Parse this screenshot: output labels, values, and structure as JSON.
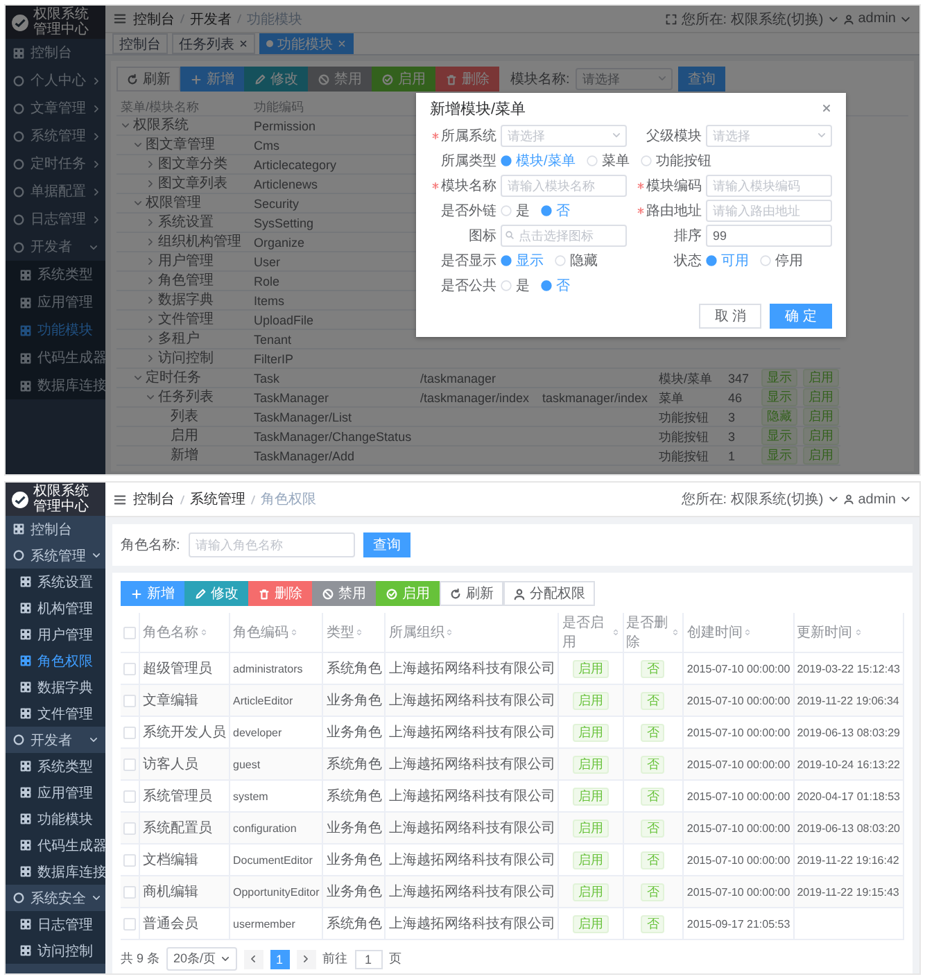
{
  "module_screen": {
    "sidebar": {
      "title": "权限系统管理中心",
      "items": [
        {
          "label": "控制台",
          "selected": false
        },
        {
          "label": "个人中心",
          "selected": false,
          "expanded": false
        },
        {
          "label": "文章管理",
          "selected": false,
          "expanded": false
        },
        {
          "label": "系统管理",
          "selected": false,
          "expanded": false
        },
        {
          "label": "定时任务",
          "selected": false,
          "expanded": false
        },
        {
          "label": "单据配置",
          "selected": false,
          "expanded": false
        },
        {
          "label": "日志管理",
          "selected": false,
          "expanded": false
        },
        {
          "label": "开发者",
          "selected": false,
          "expanded": true,
          "children": [
            {
              "label": "系统类型",
              "selected": false
            },
            {
              "label": "应用管理",
              "selected": false
            },
            {
              "label": "功能模块",
              "selected": true
            },
            {
              "label": "代码生成器",
              "selected": false
            },
            {
              "label": "数据库连接",
              "selected": false
            }
          ]
        }
      ]
    },
    "breadcrumb": [
      "控制台",
      "开发者",
      "功能模块"
    ],
    "fullscreen_button": true,
    "location": {
      "label": "您所在:",
      "value": "权限系统(切换)"
    },
    "user": "admin",
    "tabs": [
      {
        "label": "控制台",
        "selected": false,
        "closable": false
      },
      {
        "label": "任务列表",
        "selected": false,
        "closable": true
      },
      {
        "label": "功能模块",
        "selected": true,
        "closable": true
      }
    ],
    "toolbar": [
      {
        "label": "刷新",
        "kind": "refresh"
      },
      {
        "label": "新增",
        "kind": "add"
      },
      {
        "label": "修改",
        "kind": "edit"
      },
      {
        "label": "禁用",
        "kind": "disable"
      },
      {
        "label": "启用",
        "kind": "enable"
      },
      {
        "label": "删除",
        "kind": "delete"
      }
    ],
    "filter": {
      "label": "模块名称:",
      "placeholder": "请选择",
      "button": "查询"
    },
    "tree_table": {
      "columns": [
        "菜单/模块名称",
        "功能编码"
      ],
      "rows": [
        {
          "name": "权限系统",
          "code": "Permission",
          "expanded": true,
          "children": [
            {
              "name": "图文章管理",
              "code": "Cms",
              "expanded": true,
              "children": [
                {
                  "name": "图文章分类",
                  "code": "Articlecategory",
                  "expanded": false
                },
                {
                  "name": "图文章列表",
                  "code": "Articlenews",
                  "expanded": false
                }
              ]
            },
            {
              "name": "权限管理",
              "code": "Security",
              "expanded": true,
              "children": [
                {
                  "name": "系统设置",
                  "code": "SysSetting",
                  "expanded": false
                },
                {
                  "name": "组织机构管理",
                  "code": "Organize",
                  "expanded": false
                },
                {
                  "name": "用户管理",
                  "code": "User",
                  "expanded": false
                },
                {
                  "name": "角色管理",
                  "code": "Role",
                  "expanded": false
                },
                {
                  "name": "数据字典",
                  "code": "Items",
                  "expanded": false
                },
                {
                  "name": "文件管理",
                  "code": "UploadFile",
                  "expanded": false
                },
                {
                  "name": "多租户",
                  "code": "Tenant",
                  "expanded": false
                },
                {
                  "name": "访问控制",
                  "code": "FilterIP",
                  "expanded": false
                }
              ]
            },
            {
              "name": "定时任务",
              "code": "Task",
              "url": "/taskmanager",
              "type": "模块/菜单",
              "sort": "347",
              "show": "显示",
              "status": "启用",
              "expanded": true,
              "children": [
                {
                  "name": "任务列表",
                  "code": "TaskManager",
                  "url": "/taskmanager/index",
                  "component": "taskmanager/index",
                  "type": "菜单",
                  "sort": "46",
                  "show": "显示",
                  "status": "启用",
                  "expanded": true,
                  "children": [
                    {
                      "name": "列表",
                      "code": "TaskManager/List",
                      "type": "功能按钮",
                      "sort": "3",
                      "show": "隐藏",
                      "status": "启用"
                    },
                    {
                      "name": "启用",
                      "code": "TaskManager/ChangeStatus",
                      "type": "功能按钮",
                      "sort": "3",
                      "show": "显示",
                      "status": "启用"
                    },
                    {
                      "name": "新增",
                      "code": "TaskManager/Add",
                      "type": "功能按钮",
                      "sort": "1",
                      "show": "显示",
                      "status": "启用"
                    }
                  ]
                }
              ]
            }
          ]
        }
      ]
    },
    "dialog": {
      "title": "新增模块/菜单",
      "rows": [
        [
          {
            "kind": "select",
            "label": "所属系统",
            "required": true,
            "placeholder": "请选择"
          },
          {
            "kind": "select",
            "label": "父级模块",
            "required": false,
            "placeholder": "请选择"
          }
        ],
        [
          {
            "kind": "radio",
            "label": "所属类型",
            "required": false,
            "options": [
              {
                "label": "模块/菜单",
                "selected": true
              },
              {
                "label": "菜单",
                "selected": false
              },
              {
                "label": "功能按钮",
                "selected": false
              }
            ]
          }
        ],
        [
          {
            "kind": "input",
            "label": "模块名称",
            "required": true,
            "placeholder": "请输入模块名称"
          },
          {
            "kind": "input",
            "label": "模块编码",
            "required": true,
            "placeholder": "请输入模块编码"
          }
        ],
        [
          {
            "kind": "radio",
            "label": "是否外链",
            "required": false,
            "options": [
              {
                "label": "是",
                "selected": false
              },
              {
                "label": "否",
                "selected": true
              }
            ]
          },
          {
            "kind": "input",
            "label": "路由地址",
            "required": true,
            "placeholder": "请输入路由地址"
          }
        ],
        [
          {
            "kind": "icon",
            "label": "图标",
            "required": false,
            "placeholder": "点击选择图标"
          },
          {
            "kind": "input",
            "label": "排序",
            "required": false,
            "value": "99"
          }
        ],
        [
          {
            "kind": "radio",
            "label": "是否显示",
            "required": false,
            "options": [
              {
                "label": "显示",
                "selected": true
              },
              {
                "label": "隐藏",
                "selected": false
              }
            ]
          },
          {
            "kind": "radio",
            "label": "状态",
            "required": false,
            "options": [
              {
                "label": "可用",
                "selected": true
              },
              {
                "label": "停用",
                "selected": false
              }
            ]
          }
        ],
        [
          {
            "kind": "radio",
            "label": "是否公共",
            "required": false,
            "options": [
              {
                "label": "是",
                "selected": false
              },
              {
                "label": "否",
                "selected": true
              }
            ]
          }
        ]
      ],
      "buttons": [
        {
          "label": "取 消",
          "kind": "cancel"
        },
        {
          "label": "确 定",
          "kind": "primary"
        }
      ]
    }
  },
  "role_screen": {
    "sidebar": {
      "title": "权限系统管理中心",
      "items": [
        {
          "label": "控制台",
          "selected": false
        },
        {
          "label": "系统管理",
          "selected": false,
          "expanded": true,
          "children": [
            {
              "label": "系统设置",
              "selected": false
            },
            {
              "label": "机构管理",
              "selected": false
            },
            {
              "label": "用户管理",
              "selected": false
            },
            {
              "label": "角色权限",
              "selected": true
            },
            {
              "label": "数据字典",
              "selected": false
            },
            {
              "label": "文件管理",
              "selected": false
            }
          ]
        },
        {
          "label": "开发者",
          "selected": false,
          "expanded": true,
          "children": [
            {
              "label": "系统类型",
              "selected": false
            },
            {
              "label": "应用管理",
              "selected": false
            },
            {
              "label": "功能模块",
              "selected": false
            },
            {
              "label": "代码生成器",
              "selected": false
            },
            {
              "label": "数据库连接",
              "selected": false
            }
          ]
        },
        {
          "label": "系统安全",
          "selected": false,
          "expanded": true,
          "children": [
            {
              "label": "日志管理",
              "selected": false
            },
            {
              "label": "访问控制",
              "selected": false
            }
          ]
        }
      ]
    },
    "breadcrumb": [
      "控制台",
      "系统管理",
      "角色权限"
    ],
    "location": {
      "label": "您所在:",
      "value": "权限系统(切换)"
    },
    "user": "admin",
    "search": {
      "label": "角色名称:",
      "placeholder": "请输入角色名称",
      "button": "查询"
    },
    "toolbar": [
      {
        "label": "新增",
        "kind": "add"
      },
      {
        "label": "修改",
        "kind": "edit"
      },
      {
        "label": "删除",
        "kind": "delete"
      },
      {
        "label": "禁用",
        "kind": "disable"
      },
      {
        "label": "启用",
        "kind": "enable"
      },
      {
        "label": "刷新",
        "kind": "refresh"
      },
      {
        "label": "分配权限",
        "kind": "assign"
      }
    ],
    "table": {
      "all_checked": false,
      "columns": [
        {
          "label": "角色名称",
          "kind": "text"
        },
        {
          "label": "角色编码",
          "kind": "text"
        },
        {
          "label": "类型",
          "kind": "text"
        },
        {
          "label": "所属组织",
          "kind": "text"
        },
        {
          "label": "是否启用",
          "kind": "tag"
        },
        {
          "label": "是否删除",
          "kind": "tag"
        },
        {
          "label": "创建时间",
          "kind": "text"
        },
        {
          "label": "更新时间",
          "kind": "text"
        }
      ],
      "rows": [
        {
          "checked": false,
          "cells": [
            "超级管理员",
            "administrators",
            "系统角色",
            "上海越拓网络科技有限公司",
            "启用",
            "否",
            "2015-07-10 00:00:00",
            "2019-03-22 15:12:43"
          ]
        },
        {
          "checked": false,
          "cells": [
            "文章编辑",
            "ArticleEditor",
            "业务角色",
            "上海越拓网络科技有限公司",
            "启用",
            "否",
            "2015-07-10 00:00:00",
            "2019-11-22 19:06:34"
          ]
        },
        {
          "checked": false,
          "cells": [
            "系统开发人员",
            "developer",
            "业务角色",
            "上海越拓网络科技有限公司",
            "启用",
            "否",
            "2015-07-10 00:00:00",
            "2019-06-13 08:03:29"
          ]
        },
        {
          "checked": false,
          "cells": [
            "访客人员",
            "guest",
            "系统角色",
            "上海越拓网络科技有限公司",
            "启用",
            "否",
            "2015-07-10 00:00:00",
            "2019-10-24 16:13:22"
          ]
        },
        {
          "checked": false,
          "cells": [
            "系统管理员",
            "system",
            "系统角色",
            "上海越拓网络科技有限公司",
            "启用",
            "否",
            "2015-07-10 00:00:00",
            "2020-04-17 01:18:53"
          ]
        },
        {
          "checked": false,
          "cells": [
            "系统配置员",
            "configuration",
            "业务角色",
            "上海越拓网络科技有限公司",
            "启用",
            "否",
            "2015-07-10 00:00:00",
            "2019-06-13 08:03:20"
          ]
        },
        {
          "checked": false,
          "cells": [
            "文档编辑",
            "DocumentEditor",
            "业务角色",
            "上海越拓网络科技有限公司",
            "启用",
            "否",
            "2015-07-10 00:00:00",
            "2019-11-22 19:16:42"
          ]
        },
        {
          "checked": false,
          "cells": [
            "商机编辑",
            "OpportunityEditor",
            "业务角色",
            "上海越拓网络科技有限公司",
            "启用",
            "否",
            "2015-07-10 00:00:00",
            "2019-11-22 19:15:43"
          ]
        },
        {
          "checked": false,
          "cells": [
            "普通会员",
            "usermember",
            "系统角色",
            "上海越拓网络科技有限公司",
            "启用",
            "否",
            "2015-09-17 21:05:53"
          ]
        }
      ]
    },
    "pagination": {
      "total": "共 9 条",
      "page_size": "20条/页",
      "pages": [
        {
          "label": "1",
          "selected": true
        }
      ],
      "goto_label": "前往",
      "goto_value": "1",
      "goto_suffix": "页"
    }
  }
}
